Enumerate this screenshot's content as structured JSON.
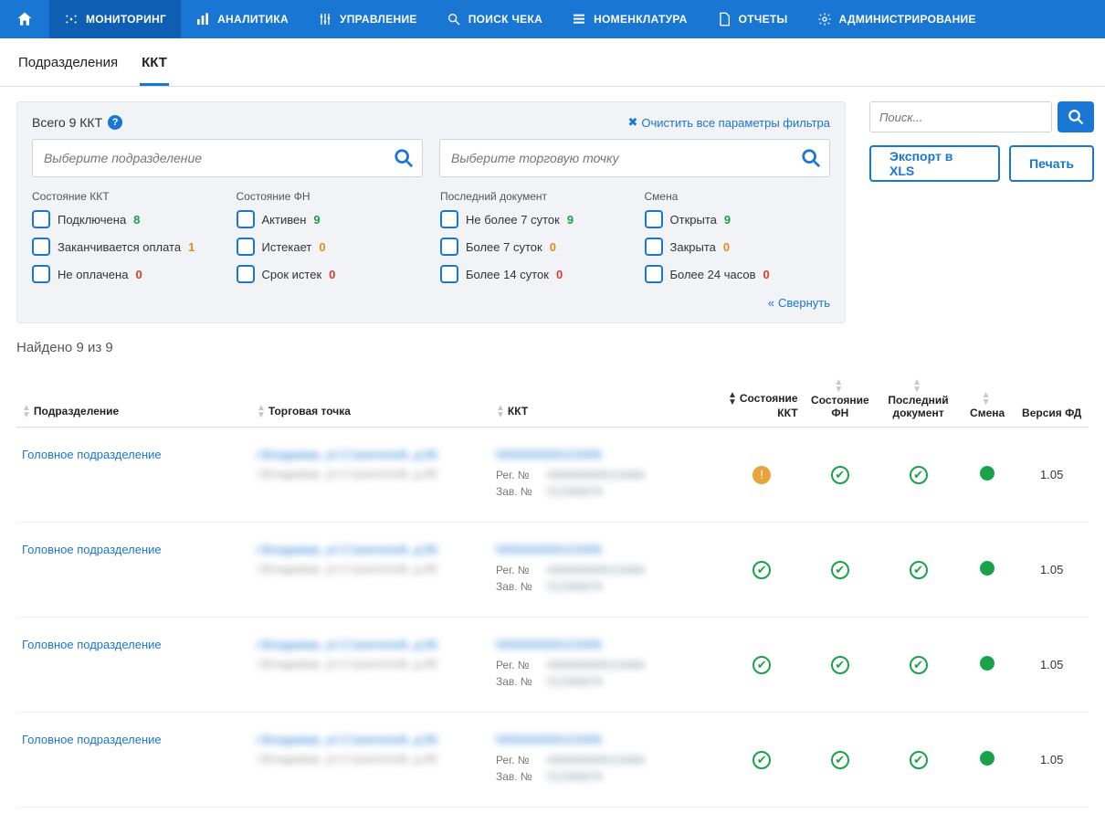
{
  "nav": {
    "items": [
      "МОНИТОРИНГ",
      "АНАЛИТИКА",
      "УПРАВЛЕНИЕ",
      "ПОИСК ЧЕКА",
      "НОМЕНКЛАТУРА",
      "ОТЧЕТЫ",
      "АДМИНИСТРИРОВАНИЕ"
    ]
  },
  "subnav": {
    "tabs": [
      "Подразделения",
      "ККТ"
    ]
  },
  "filter": {
    "total_label": "Всего 9 ККТ",
    "clear": "Очистить все параметры фильтра",
    "search_dept_placeholder": "Выберите подразделение",
    "search_point_placeholder": "Выберите торговую точку",
    "collapse": "Свернуть",
    "groups": [
      {
        "title": "Состояние ККТ",
        "rows": [
          {
            "label": "Подключена",
            "count": "8",
            "cls": "cnt-green"
          },
          {
            "label": "Заканчивается оплата",
            "count": "1",
            "cls": "cnt-orange"
          },
          {
            "label": "Не оплачена",
            "count": "0",
            "cls": "cnt-red"
          }
        ]
      },
      {
        "title": "Состояние ФН",
        "rows": [
          {
            "label": "Активен",
            "count": "9",
            "cls": "cnt-green"
          },
          {
            "label": "Истекает",
            "count": "0",
            "cls": "cnt-orange"
          },
          {
            "label": "Срок истек",
            "count": "0",
            "cls": "cnt-red"
          }
        ]
      },
      {
        "title": "Последний документ",
        "rows": [
          {
            "label": "Не более 7 суток",
            "count": "9",
            "cls": "cnt-green"
          },
          {
            "label": "Более 7 суток",
            "count": "0",
            "cls": "cnt-orange"
          },
          {
            "label": "Более 14 суток",
            "count": "0",
            "cls": "cnt-red"
          }
        ]
      },
      {
        "title": "Смена",
        "rows": [
          {
            "label": "Открыта",
            "count": "9",
            "cls": "cnt-green"
          },
          {
            "label": "Закрыта",
            "count": "0",
            "cls": "cnt-orange"
          },
          {
            "label": "Более 24 часов",
            "count": "0",
            "cls": "cnt-red"
          }
        ]
      }
    ]
  },
  "side": {
    "search_placeholder": "Поиск...",
    "export": "Экспорт в XLS",
    "print": "Печать"
  },
  "results": {
    "count_label": "Найдено 9 из 9",
    "columns": [
      "Подразделение",
      "Торговая точка",
      "ККТ",
      "Состояние ККТ",
      "Состояние ФН",
      "Последний документ",
      "Смена",
      "Версия ФД"
    ],
    "reg_label": "Рег. №",
    "zav_label": "Зав. №",
    "rows": [
      {
        "dept": "Головное подразделение",
        "warn": true,
        "version": "1.05"
      },
      {
        "dept": "Головное подразделение",
        "warn": false,
        "version": "1.05"
      },
      {
        "dept": "Головное подразделение",
        "warn": false,
        "version": "1.05"
      },
      {
        "dept": "Головное подразделение",
        "warn": false,
        "version": "1.05"
      }
    ]
  }
}
